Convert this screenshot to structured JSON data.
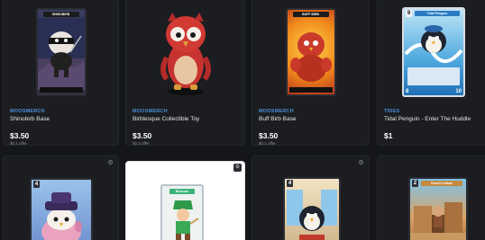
{
  "colors": {
    "background": "#141619",
    "card": "#1b1d21",
    "brand": "#4d8fd6"
  },
  "row1": [
    {
      "brand": "MOOSMERCH",
      "name": "Shinobirb Base",
      "price": "$3.50",
      "offer": "$0.1 offer",
      "card_header": "SHINOBIRB"
    },
    {
      "brand": "MOOSMERCH",
      "name": "Birblesque Collectible Toy",
      "price": "$3.50",
      "offer": "$2.3 offer"
    },
    {
      "brand": "MOOSMERCH",
      "name": "Buff Birb Base",
      "price": "$3.50",
      "offer": "$0.1 offer",
      "card_header": "BUFF BIRB"
    },
    {
      "brand": "TIDES",
      "name": "Tidal Penguin - Enter The Huddle",
      "price": "$1",
      "offer": "",
      "card_header": "Tidal Penguin",
      "card_num": "9",
      "card_stat_left": "8",
      "card_stat_right": "10"
    }
  ],
  "row2": [
    {
      "card_num": "4",
      "icon": "gear-icon"
    },
    {
      "card_header": "Birbcoin",
      "icon": "gear-icon"
    },
    {
      "card_num": "4",
      "icon": "gear-icon"
    },
    {
      "card_num": "2",
      "card_header": "Desert Outlaw"
    }
  ]
}
